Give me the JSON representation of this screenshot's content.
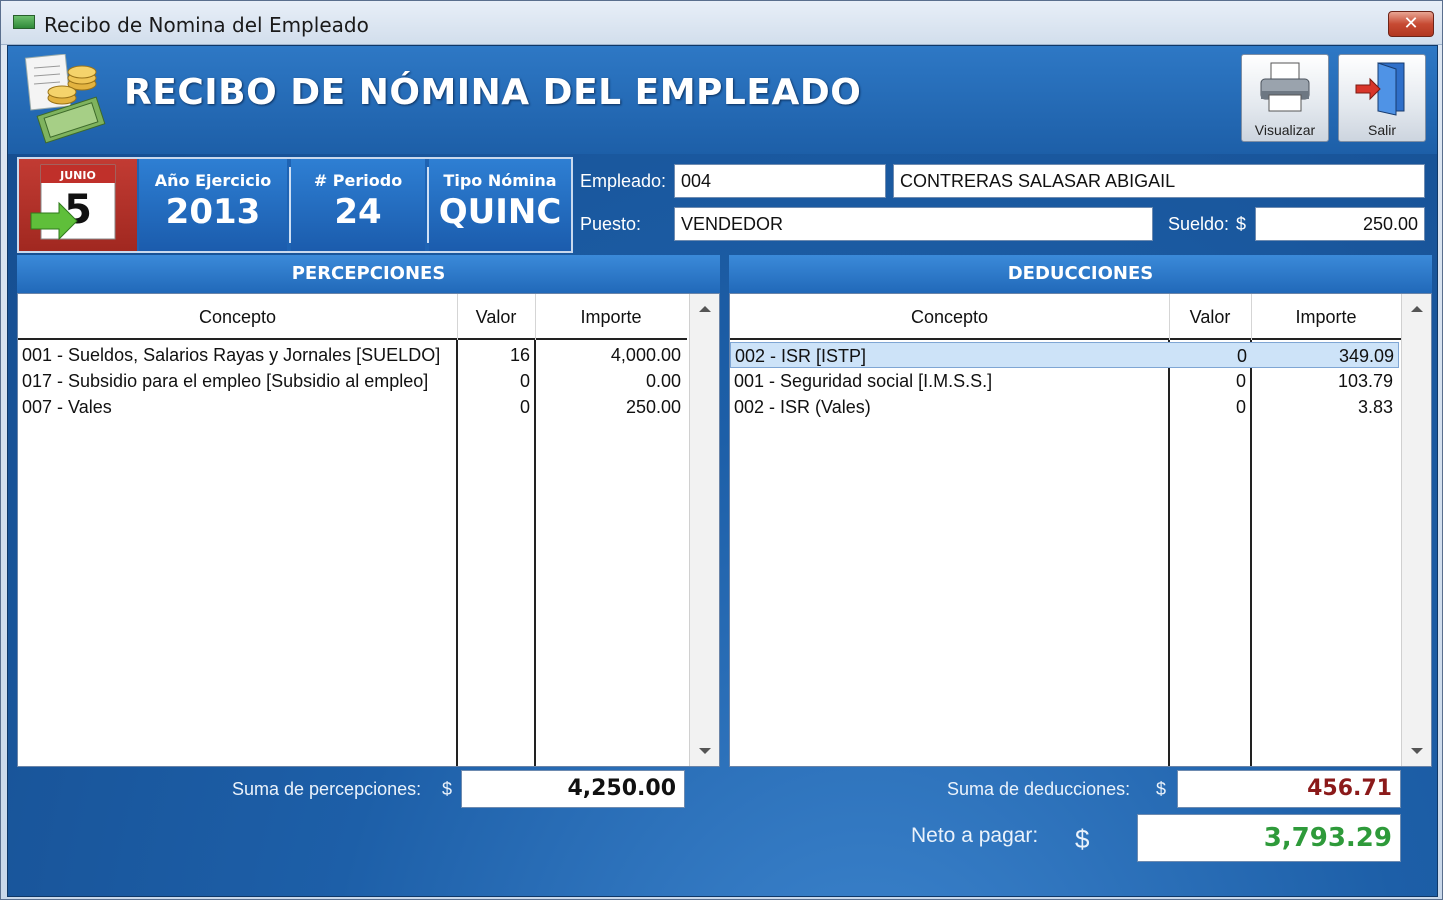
{
  "window": {
    "title": "Recibo de Nomina del Empleado",
    "close_label": "✕"
  },
  "header": {
    "title": "RECIBO DE NÓMINA DEL EMPLEADO",
    "visualizar_label": "Visualizar",
    "salir_label": "Salir"
  },
  "period": {
    "calendar_month": "JUNIO",
    "calendar_day": "5",
    "anio_label": "Año Ejercicio",
    "anio_value": "2013",
    "periodo_label": "# Periodo",
    "periodo_value": "24",
    "tipo_label": "Tipo Nómina",
    "tipo_value": "QUINC"
  },
  "employee": {
    "empleado_label": "Empleado:",
    "empleado_id": "004",
    "empleado_nombre": "CONTRERAS SALASAR ABIGAIL",
    "puesto_label": "Puesto:",
    "puesto_value": "VENDEDOR",
    "sueldo_label": "Sueldo:",
    "sueldo_currency": "$",
    "sueldo_value": "250.00"
  },
  "percepciones": {
    "title": "PERCEPCIONES",
    "columns": [
      "Concepto",
      "Valor",
      "Importe"
    ],
    "rows": [
      {
        "concepto": "001 - Sueldos, Salarios Rayas y Jornales  [SUELDO]",
        "valor": "16",
        "importe": "4,000.00"
      },
      {
        "concepto": "017 - Subsidio para el empleo  [Subsidio al empleo]",
        "valor": "0",
        "importe": "0.00"
      },
      {
        "concepto": "007 - Vales",
        "valor": "0",
        "importe": "250.00"
      }
    ],
    "sum_label": "Suma de percepciones:",
    "sum_currency": "$",
    "sum_value": "4,250.00"
  },
  "deducciones": {
    "title": "DEDUCCIONES",
    "columns": [
      "Concepto",
      "Valor",
      "Importe"
    ],
    "rows": [
      {
        "concepto": "002 - ISR  [ISTP]",
        "valor": "0",
        "importe": "349.09"
      },
      {
        "concepto": "001 - Seguridad social  [I.M.S.S.]",
        "valor": "0",
        "importe": "103.79"
      },
      {
        "concepto": "002 - ISR (Vales)",
        "valor": "0",
        "importe": "3.83"
      }
    ],
    "sum_label": "Suma de deducciones:",
    "sum_currency": "$",
    "sum_value": "456.71"
  },
  "neto": {
    "label": "Neto a pagar:",
    "currency": "$",
    "value": "3,793.29"
  },
  "colors": {
    "deducciones_total": "#8b1a1a",
    "neto_total": "#2e9a3a",
    "selected_row": "#cde3f8"
  }
}
